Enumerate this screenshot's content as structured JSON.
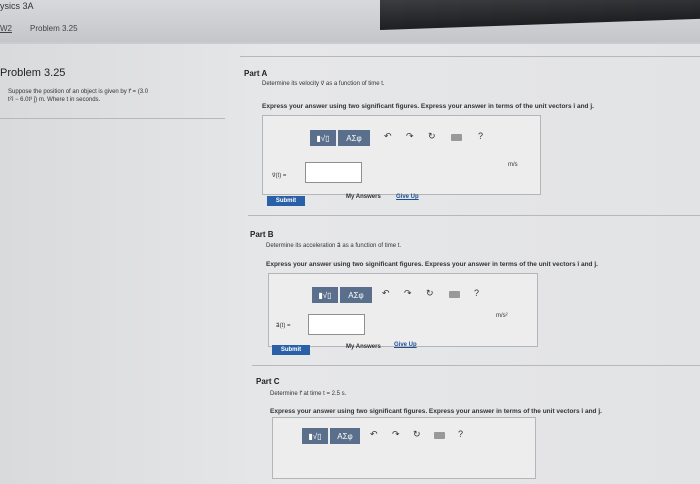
{
  "header": {
    "course": "ysics 3A",
    "breadcrumb_1": "W2",
    "breadcrumb_2": "Problem 3.25"
  },
  "problem": {
    "title": "Problem 3.25",
    "text_line1": "Suppose the position of an object is given by r⃗ = (3.0",
    "text_line2": "t²î − 6.0t³ ĵ) m. Where t in seconds."
  },
  "parts": [
    {
      "label": "Part A",
      "question": "Determine its velocity v⃗ as a function of time t.",
      "instruction": "Express your answer using two significant figures. Express your answer in terms of the unit vectors î and ĵ.",
      "var_label": "v⃗(t) =",
      "unit": "m/s",
      "submit": "Submit",
      "my_answers": "My Answers",
      "give_up": "Give Up"
    },
    {
      "label": "Part B",
      "question": "Determine its acceleration a⃗ as a function of time t.",
      "instruction": "Express your answer using two significant figures. Express your answer in terms of the unit vectors î and ĵ.",
      "var_label": "a⃗(t) =",
      "unit": "m/s²",
      "submit": "Submit",
      "my_answers": "My Answers",
      "give_up": "Give Up"
    },
    {
      "label": "Part C",
      "question": "Determine r⃗ at time t = 2.5 s.",
      "instruction": "Express your answer using two significant figures. Express your answer in terms of the unit vectors î and ĵ."
    }
  ],
  "toolbar": {
    "template_label": "▮√▯",
    "greek_label": "ΑΣφ",
    "undo": "↶",
    "redo": "↷",
    "reset": "↻",
    "help": "?"
  },
  "colors": {
    "toolbar_blue": "#5a6f8c",
    "submit_blue": "#2a60a8"
  }
}
